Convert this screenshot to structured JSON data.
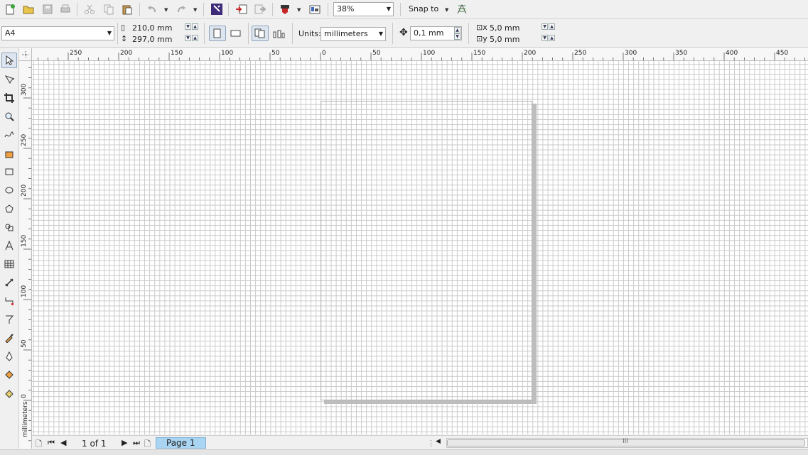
{
  "toolbar": {
    "zoom": "38%",
    "snap_label": "Snap to",
    "icons": [
      "new-icon",
      "open-icon",
      "save-icon",
      "print-icon",
      "cut-icon",
      "copy-icon",
      "paste-icon",
      "undo-icon",
      "redo-icon",
      "import-icon",
      "export-icon",
      "publish-pdf-icon",
      "app-launcher-icon",
      "welcome-screen-icon",
      "snap-options-icon"
    ]
  },
  "propbar": {
    "page_size": "A4",
    "width": "210,0 mm",
    "height": "297,0 mm",
    "units_label": "Units:",
    "units": "millimeters",
    "nudge": "0,1 mm",
    "dup_x": "5,0 mm",
    "dup_y": "5,0 mm"
  },
  "rulers": {
    "h_labels": [
      "250",
      "200",
      "150",
      "100",
      "50",
      "0",
      "50",
      "100",
      "150",
      "200",
      "250",
      "300",
      "350",
      "400",
      "450",
      "mill"
    ],
    "v_labels": [
      "300",
      "250",
      "200",
      "150",
      "100",
      "50",
      "0"
    ],
    "unit": "millimeters"
  },
  "status": {
    "page_count": "1 of 1",
    "page_tab": "Page 1",
    "scroll_grip": "III"
  },
  "colors": {
    "accent_tab": "#a9d4f2",
    "grid": "#c9c9c9"
  }
}
